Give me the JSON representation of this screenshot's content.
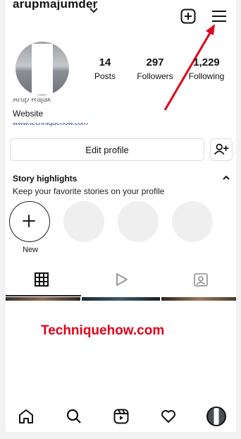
{
  "header": {
    "username": "arupmajumder",
    "menu_icon": "hamburger-menu-icon",
    "create_icon": "plus-square-icon"
  },
  "profile": {
    "stats": [
      {
        "count": "14",
        "label": "Posts"
      },
      {
        "count": "297",
        "label": "Followers"
      },
      {
        "count": "1,229",
        "label": "Following"
      }
    ],
    "bio_name": "Arup Rajak",
    "bio_line": "Website",
    "bio_link": "www.techniquehow.com"
  },
  "actions": {
    "edit_profile": "Edit profile"
  },
  "story_highlights": {
    "title": "Story highlights",
    "subtitle": "Keep your favorite stories on your profile",
    "new_label": "New"
  },
  "watermark": "Techniquehow.com",
  "colors": {
    "arrow": "#e0001b",
    "watermark": "#e0001b"
  }
}
